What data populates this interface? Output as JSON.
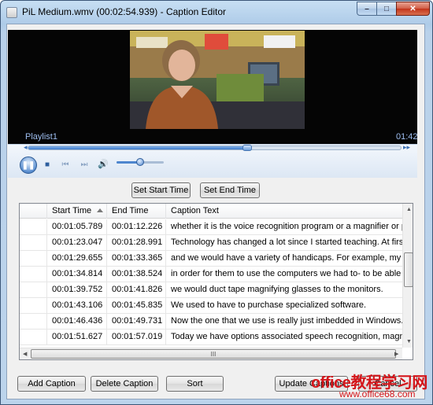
{
  "window": {
    "title": "PiL Medium.wmv (00:02:54.939) - Caption Editor",
    "controls": {
      "minimize": "–",
      "maximize": "□",
      "close": "✕"
    }
  },
  "player": {
    "playlist_label": "Playlist1",
    "elapsed_time": "01:42",
    "seek_progress": 0.59,
    "volume_level": 0.45,
    "icons": {
      "skip_back": "◂◂",
      "skip_forward": "▸▸",
      "play_pause": "❚❚",
      "stop": "■",
      "previous": "⏮",
      "next": "⏭",
      "volume": "🔊"
    }
  },
  "editor": {
    "set_start_time": "Set Start Time",
    "set_end_time": "Set End Time",
    "columns": [
      "Start Time",
      "End Time",
      "Caption Text"
    ],
    "rows": [
      {
        "start": "00:01:05.789",
        "end": "00:01:12.226",
        "text": "whether it is the voice recognition program or a magnifier or pos..."
      },
      {
        "start": "00:01:23.047",
        "end": "00:01:28.991",
        "text": "Technology has changed a lot since I started teaching. At first I ..."
      },
      {
        "start": "00:01:29.655",
        "end": "00:01:33.365",
        "text": "and we would have a variety of handicaps. For example, my vis..."
      },
      {
        "start": "00:01:34.814",
        "end": "00:01:38.524",
        "text": "in order for them to use the computers we had to- to be able to ..."
      },
      {
        "start": "00:01:39.752",
        "end": "00:01:41.826",
        "text": "we would duct tape magnifying glasses to the monitors."
      },
      {
        "start": "00:01:43.106",
        "end": "00:01:45.835",
        "text": "We used to have to purchase specialized software."
      },
      {
        "start": "00:01:46.436",
        "end": "00:01:49.731",
        "text": "Now the one that we use is really just imbedded in Windows."
      },
      {
        "start": "00:01:51.627",
        "end": "00:01:57.019",
        "text": "Today we have options associated speech recognition, magnifie..."
      }
    ],
    "scroll_grip": "III"
  },
  "footer": {
    "add_caption": "Add Caption",
    "delete_caption": "Delete Caption",
    "sort": "Sort",
    "update_captions": "Update Captions",
    "cancel": "Cancel"
  },
  "watermark": {
    "main": "office教程学习网",
    "url": "www.office68.com"
  }
}
